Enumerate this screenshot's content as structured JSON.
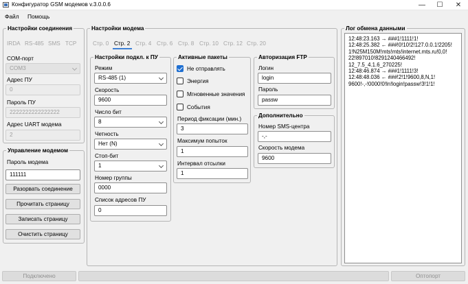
{
  "window": {
    "title": "Конфигуратор GSM модемов v.3.0.0.6",
    "minimize": "—",
    "maximize": "☐",
    "close": "✕"
  },
  "menu": {
    "file": "Файл",
    "help": "Помощь"
  },
  "connection": {
    "title": "Настройки соединения",
    "tabs": [
      "IRDA",
      "RS-485",
      "SMS",
      "TCP"
    ],
    "com_port_label": "COM-порт",
    "com_port_value": "COM3",
    "pu_address_label": "Адрес ПУ",
    "pu_address_value": "0",
    "pu_password_label": "Пароль ПУ",
    "pu_password_value": "2222222222222222",
    "uart_address_label": "Адрес UART модема",
    "uart_address_value": "2"
  },
  "management": {
    "title": "Управление модемом",
    "modem_password_label": "Пароль модема",
    "modem_password_value": "111111",
    "disconnect_btn": "Разорвать соединение",
    "read_btn": "Прочитать страницу",
    "write_btn": "Записать страницу",
    "clear_btn": "Очистить страницу"
  },
  "modem": {
    "title": "Настройки модема",
    "pages": [
      "Стр. 0",
      "Стр. 2",
      "Стр. 4",
      "Стр. 6",
      "Стр. 8",
      "Стр. 10",
      "Стр. 12",
      "Стр. 20"
    ],
    "active_page": "Стр. 2"
  },
  "pu_conn": {
    "title": "Настройки подкл. к ПУ",
    "mode_label": "Режим",
    "mode_value": "RS-485 (1)",
    "speed_label": "Скорость",
    "speed_value": "9600",
    "bits_label": "Число бит",
    "bits_value": "8",
    "parity_label": "Четность",
    "parity_value": "Нет (N)",
    "stop_label": "Стоп-бит",
    "stop_value": "1",
    "group_label": "Номер группы",
    "group_value": "0000",
    "addr_list_label": "Список адресов ПУ",
    "addr_list_value": "0"
  },
  "packets": {
    "title": "Активные пакеты",
    "items": [
      {
        "label": "Не отправлять",
        "checked": true
      },
      {
        "label": "Энергия",
        "checked": false
      },
      {
        "label": "Мгновенные значения",
        "checked": false
      },
      {
        "label": "События",
        "checked": false
      }
    ],
    "fix_period_label": "Период фиксации (мин.)",
    "fix_period_value": "3",
    "max_attempts_label": "Максимум попыток",
    "max_attempts_value": "1",
    "interval_label": "Интервал отсылки",
    "interval_value": "1"
  },
  "ftp": {
    "title": "Авторизация FTP",
    "login_label": "Логин",
    "login_value": "login",
    "password_label": "Пароль",
    "password_value": "passw"
  },
  "extra": {
    "title": "Дополнительно",
    "sms_center_label": "Номер SMS-центра",
    "sms_center_value": "-,-",
    "modem_speed_label": "Скорость модема",
    "modem_speed_value": "9600"
  },
  "log": {
    "title": "Лог обмена данными",
    "lines": [
      "12:48:23.163 → ###1!1111!1!",
      "12:48:25.382 ← ###!0!10!2!127.0.0.1!2205!",
      "1!N25M150M!mts!mts!internet.mts.ru!0,0!",
      "22!897010!8291240466492!",
      "12_7.5_4.1.6_270225!",
      "12:48:46.874 → ###1!1111!3!",
      "12:48:48.036 ← ###!2!1!9600,8,N,1!",
      "9600!-,-!0000!0!ln!login!passw!3!1!1!"
    ]
  },
  "status": {
    "left": "Подключено",
    "right": "Оптопорт"
  }
}
